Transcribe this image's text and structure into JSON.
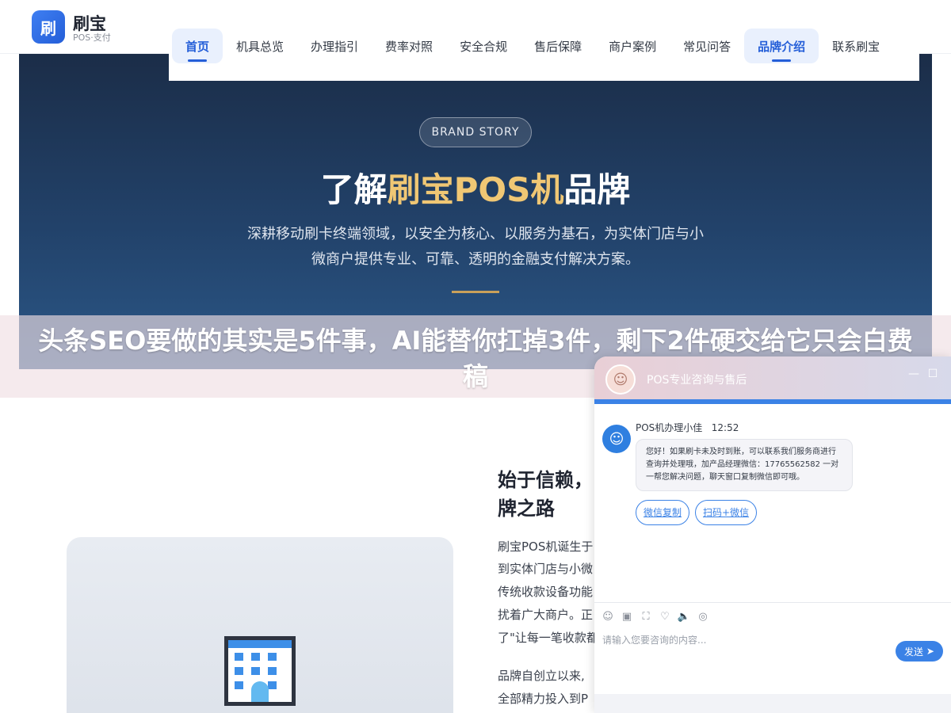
{
  "brand": {
    "logo_char": "刷",
    "name": "刷宝",
    "sub": "POS·支付"
  },
  "nav": {
    "items": [
      "首页",
      "机具总览",
      "办理指引",
      "费率对照",
      "安全合规",
      "售后保障",
      "商户案例",
      "常见问答",
      "品牌介绍",
      "联系刷宝"
    ],
    "active": [
      "首页",
      "品牌介绍"
    ]
  },
  "hero": {
    "badge": "BRAND STORY",
    "title_prefix": "了解",
    "title_highlight": "刷宝POS机",
    "title_suffix": "品牌",
    "desc_line1": "深耕移动刷卡终端领域，以安全为核心、以服务为基石，为实体门店与小",
    "desc_line2": "微商户提供专业、可靠、透明的金融支付解决方案。"
  },
  "article": {
    "title": "头条SEO要做的其实是5件事，AI能替你扛掉3件，剩下2件硬交给它只会白费稿"
  },
  "section": {
    "title_line1": "始于信赖，",
    "title_line2": "牌之路",
    "paragraphs": [
      "刷宝POS机诞生于",
      "到实体门店与小微",
      "传统收款设备功能",
      "扰着广大商户。正",
      "了\"让每一笔收款都",
      "品牌自创立以来,",
      "全部精力投入到P"
    ]
  },
  "chat": {
    "title": "POS专业咨询与售后",
    "minimize": "—",
    "maximize": "☐",
    "agent_name": "POS机办理小佳",
    "time": "12:52",
    "message": "您好！如果刷卡未及时到账，可以联系我们服务商进行查询并处理哦，加产品经理微信：17765562582 一对一帮您解决问题，聊天窗口复制微信即可哦。",
    "buttons": [
      "微信复制",
      "扫码+微信"
    ],
    "tools": [
      "☺",
      "▣",
      "⛶",
      "♡",
      "🔈",
      "◎"
    ],
    "input_placeholder": "请输入您要咨询的内容...",
    "send_label": "发送",
    "send_icon": "➤"
  },
  "colors": {
    "accent": "#245ed8",
    "hero_highlight": "#f0c774",
    "chat_blue": "#3b82e6"
  }
}
